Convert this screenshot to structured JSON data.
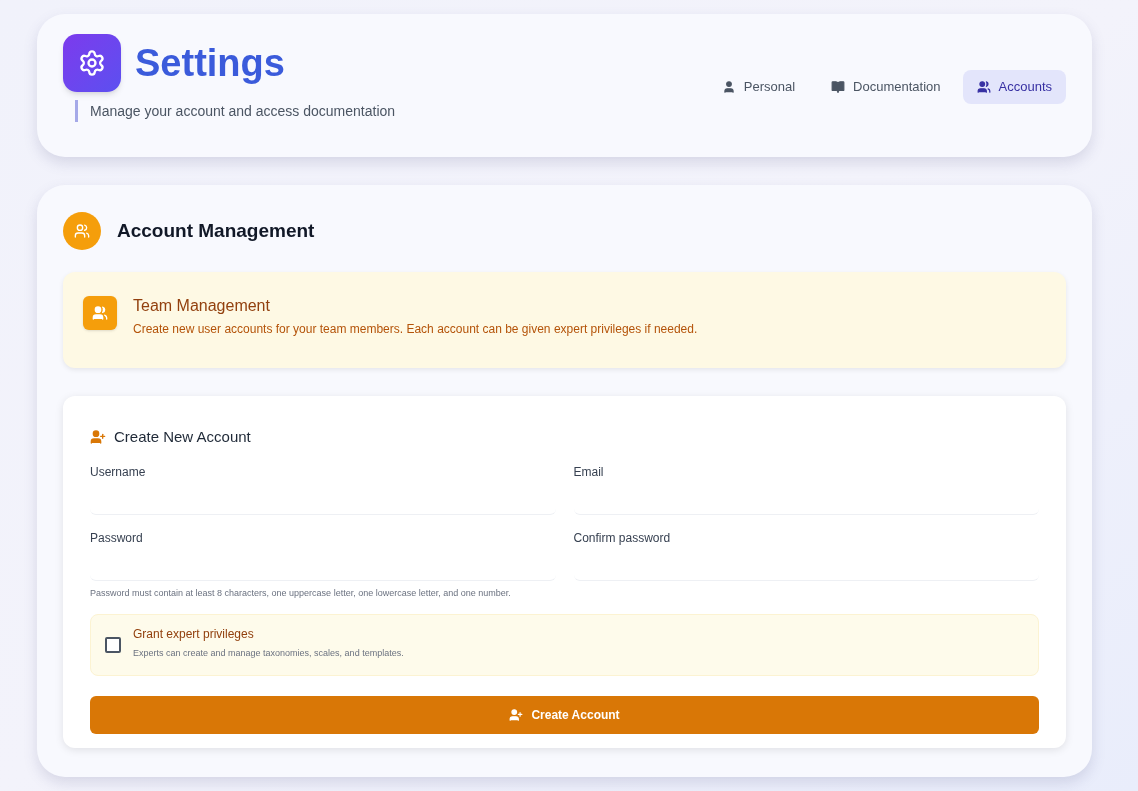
{
  "header": {
    "title": "Settings",
    "subtitle": "Manage your account and access documentation"
  },
  "tabs": [
    {
      "label": "Personal",
      "selected": false
    },
    {
      "label": "Documentation",
      "selected": false
    },
    {
      "label": "Accounts",
      "selected": true
    }
  ],
  "section": {
    "title": "Account Management"
  },
  "notice": {
    "title": "Team Management",
    "text": "Create new user accounts for your team members. Each account can be given expert privileges if needed."
  },
  "form": {
    "title": "Create New Account",
    "fields": [
      {
        "label": "Username"
      },
      {
        "label": "Email"
      },
      {
        "label": "Password"
      },
      {
        "label": "Confirm password"
      }
    ],
    "hint": "Password must contain at least 8 characters, one uppercase letter, one lowercase letter, and one number.",
    "expert": {
      "label": "Grant expert privileges",
      "text": "Experts can create and manage taxonomies, scales, and templates.",
      "checked": false
    },
    "submit": "Create Account"
  }
}
